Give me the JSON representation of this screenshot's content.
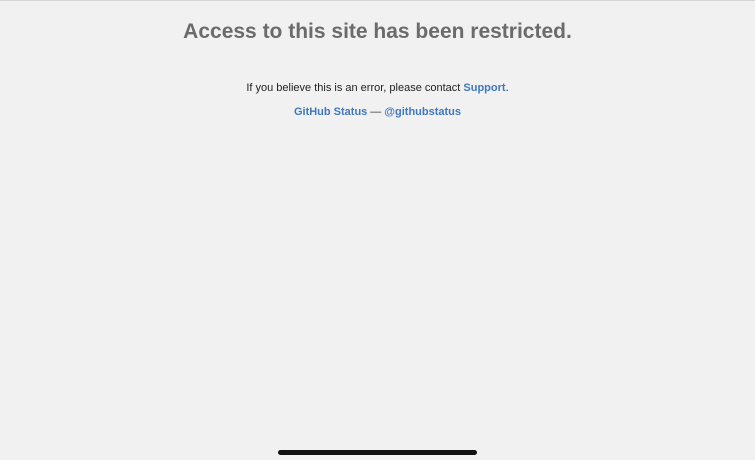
{
  "page": {
    "title": "Access to this site has been restricted.",
    "message_prefix": "If you believe this is an error, please contact ",
    "support_link": "Support",
    "message_suffix": ".",
    "status_link": "GitHub Status",
    "separator": "—",
    "twitter_link": "@githubstatus"
  },
  "colors": {
    "background": "#f1f1f1",
    "title": "#6b6b6b",
    "link": "#4078c0",
    "text": "#1f1f1f"
  }
}
